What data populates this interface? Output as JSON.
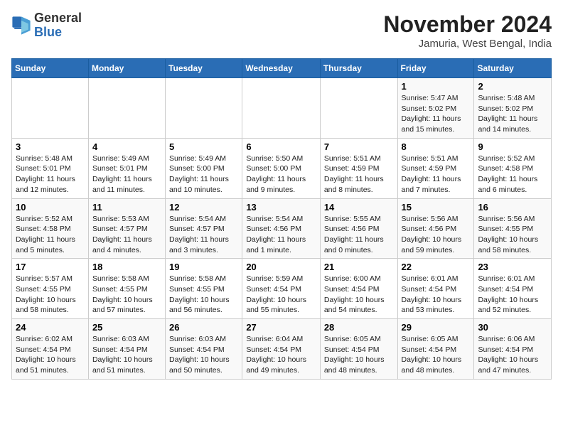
{
  "logo": {
    "general": "General",
    "blue": "Blue"
  },
  "header": {
    "month": "November 2024",
    "location": "Jamuria, West Bengal, India"
  },
  "weekdays": [
    "Sunday",
    "Monday",
    "Tuesday",
    "Wednesday",
    "Thursday",
    "Friday",
    "Saturday"
  ],
  "weeks": [
    [
      {
        "day": "",
        "info": ""
      },
      {
        "day": "",
        "info": ""
      },
      {
        "day": "",
        "info": ""
      },
      {
        "day": "",
        "info": ""
      },
      {
        "day": "",
        "info": ""
      },
      {
        "day": "1",
        "info": "Sunrise: 5:47 AM\nSunset: 5:02 PM\nDaylight: 11 hours and 15 minutes."
      },
      {
        "day": "2",
        "info": "Sunrise: 5:48 AM\nSunset: 5:02 PM\nDaylight: 11 hours and 14 minutes."
      }
    ],
    [
      {
        "day": "3",
        "info": "Sunrise: 5:48 AM\nSunset: 5:01 PM\nDaylight: 11 hours and 12 minutes."
      },
      {
        "day": "4",
        "info": "Sunrise: 5:49 AM\nSunset: 5:01 PM\nDaylight: 11 hours and 11 minutes."
      },
      {
        "day": "5",
        "info": "Sunrise: 5:49 AM\nSunset: 5:00 PM\nDaylight: 11 hours and 10 minutes."
      },
      {
        "day": "6",
        "info": "Sunrise: 5:50 AM\nSunset: 5:00 PM\nDaylight: 11 hours and 9 minutes."
      },
      {
        "day": "7",
        "info": "Sunrise: 5:51 AM\nSunset: 4:59 PM\nDaylight: 11 hours and 8 minutes."
      },
      {
        "day": "8",
        "info": "Sunrise: 5:51 AM\nSunset: 4:59 PM\nDaylight: 11 hours and 7 minutes."
      },
      {
        "day": "9",
        "info": "Sunrise: 5:52 AM\nSunset: 4:58 PM\nDaylight: 11 hours and 6 minutes."
      }
    ],
    [
      {
        "day": "10",
        "info": "Sunrise: 5:52 AM\nSunset: 4:58 PM\nDaylight: 11 hours and 5 minutes."
      },
      {
        "day": "11",
        "info": "Sunrise: 5:53 AM\nSunset: 4:57 PM\nDaylight: 11 hours and 4 minutes."
      },
      {
        "day": "12",
        "info": "Sunrise: 5:54 AM\nSunset: 4:57 PM\nDaylight: 11 hours and 3 minutes."
      },
      {
        "day": "13",
        "info": "Sunrise: 5:54 AM\nSunset: 4:56 PM\nDaylight: 11 hours and 1 minute."
      },
      {
        "day": "14",
        "info": "Sunrise: 5:55 AM\nSunset: 4:56 PM\nDaylight: 11 hours and 0 minutes."
      },
      {
        "day": "15",
        "info": "Sunrise: 5:56 AM\nSunset: 4:56 PM\nDaylight: 10 hours and 59 minutes."
      },
      {
        "day": "16",
        "info": "Sunrise: 5:56 AM\nSunset: 4:55 PM\nDaylight: 10 hours and 58 minutes."
      }
    ],
    [
      {
        "day": "17",
        "info": "Sunrise: 5:57 AM\nSunset: 4:55 PM\nDaylight: 10 hours and 58 minutes."
      },
      {
        "day": "18",
        "info": "Sunrise: 5:58 AM\nSunset: 4:55 PM\nDaylight: 10 hours and 57 minutes."
      },
      {
        "day": "19",
        "info": "Sunrise: 5:58 AM\nSunset: 4:55 PM\nDaylight: 10 hours and 56 minutes."
      },
      {
        "day": "20",
        "info": "Sunrise: 5:59 AM\nSunset: 4:54 PM\nDaylight: 10 hours and 55 minutes."
      },
      {
        "day": "21",
        "info": "Sunrise: 6:00 AM\nSunset: 4:54 PM\nDaylight: 10 hours and 54 minutes."
      },
      {
        "day": "22",
        "info": "Sunrise: 6:01 AM\nSunset: 4:54 PM\nDaylight: 10 hours and 53 minutes."
      },
      {
        "day": "23",
        "info": "Sunrise: 6:01 AM\nSunset: 4:54 PM\nDaylight: 10 hours and 52 minutes."
      }
    ],
    [
      {
        "day": "24",
        "info": "Sunrise: 6:02 AM\nSunset: 4:54 PM\nDaylight: 10 hours and 51 minutes."
      },
      {
        "day": "25",
        "info": "Sunrise: 6:03 AM\nSunset: 4:54 PM\nDaylight: 10 hours and 51 minutes."
      },
      {
        "day": "26",
        "info": "Sunrise: 6:03 AM\nSunset: 4:54 PM\nDaylight: 10 hours and 50 minutes."
      },
      {
        "day": "27",
        "info": "Sunrise: 6:04 AM\nSunset: 4:54 PM\nDaylight: 10 hours and 49 minutes."
      },
      {
        "day": "28",
        "info": "Sunrise: 6:05 AM\nSunset: 4:54 PM\nDaylight: 10 hours and 48 minutes."
      },
      {
        "day": "29",
        "info": "Sunrise: 6:05 AM\nSunset: 4:54 PM\nDaylight: 10 hours and 48 minutes."
      },
      {
        "day": "30",
        "info": "Sunrise: 6:06 AM\nSunset: 4:54 PM\nDaylight: 10 hours and 47 minutes."
      }
    ]
  ]
}
